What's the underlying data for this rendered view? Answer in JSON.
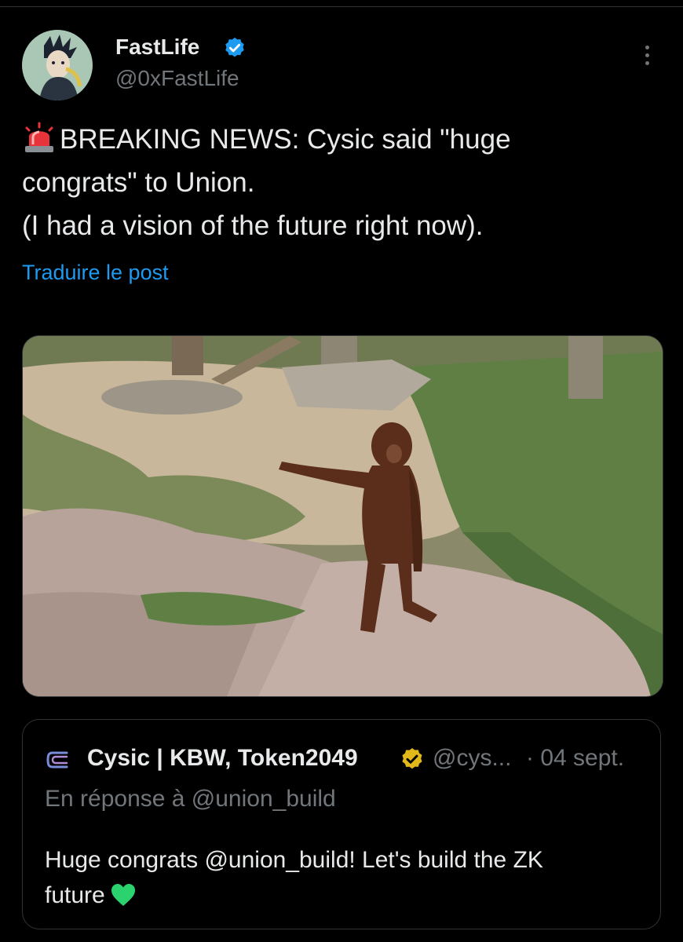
{
  "post": {
    "author_name": "FastLife",
    "author_handle": "@0xFastLife",
    "text_line1": "BREAKING NEWS: Cysic said \"huge",
    "text_line2": "congrats\" to Union.",
    "text_line3": "(I had a vision of the future right now).",
    "siren_emoji": "siren-icon",
    "translate_label": "Traduire le post",
    "verified_color": "#1d9bf0"
  },
  "quoted_post": {
    "author_name": "Cysic | KBW, Token2049",
    "author_handle": "@cys...",
    "date": "· 04 sept.",
    "reply_to": "En réponse à @union_build",
    "text_line1": "Huge congrats @union_build! Let's build the ZK",
    "text_line2": "future",
    "emoji": "green-heart-icon",
    "verified_color": "#e2b719"
  },
  "colors": {
    "background": "#000000",
    "text": "#e7e9ea",
    "secondary_text": "#71767b",
    "link": "#1d9bf0"
  }
}
